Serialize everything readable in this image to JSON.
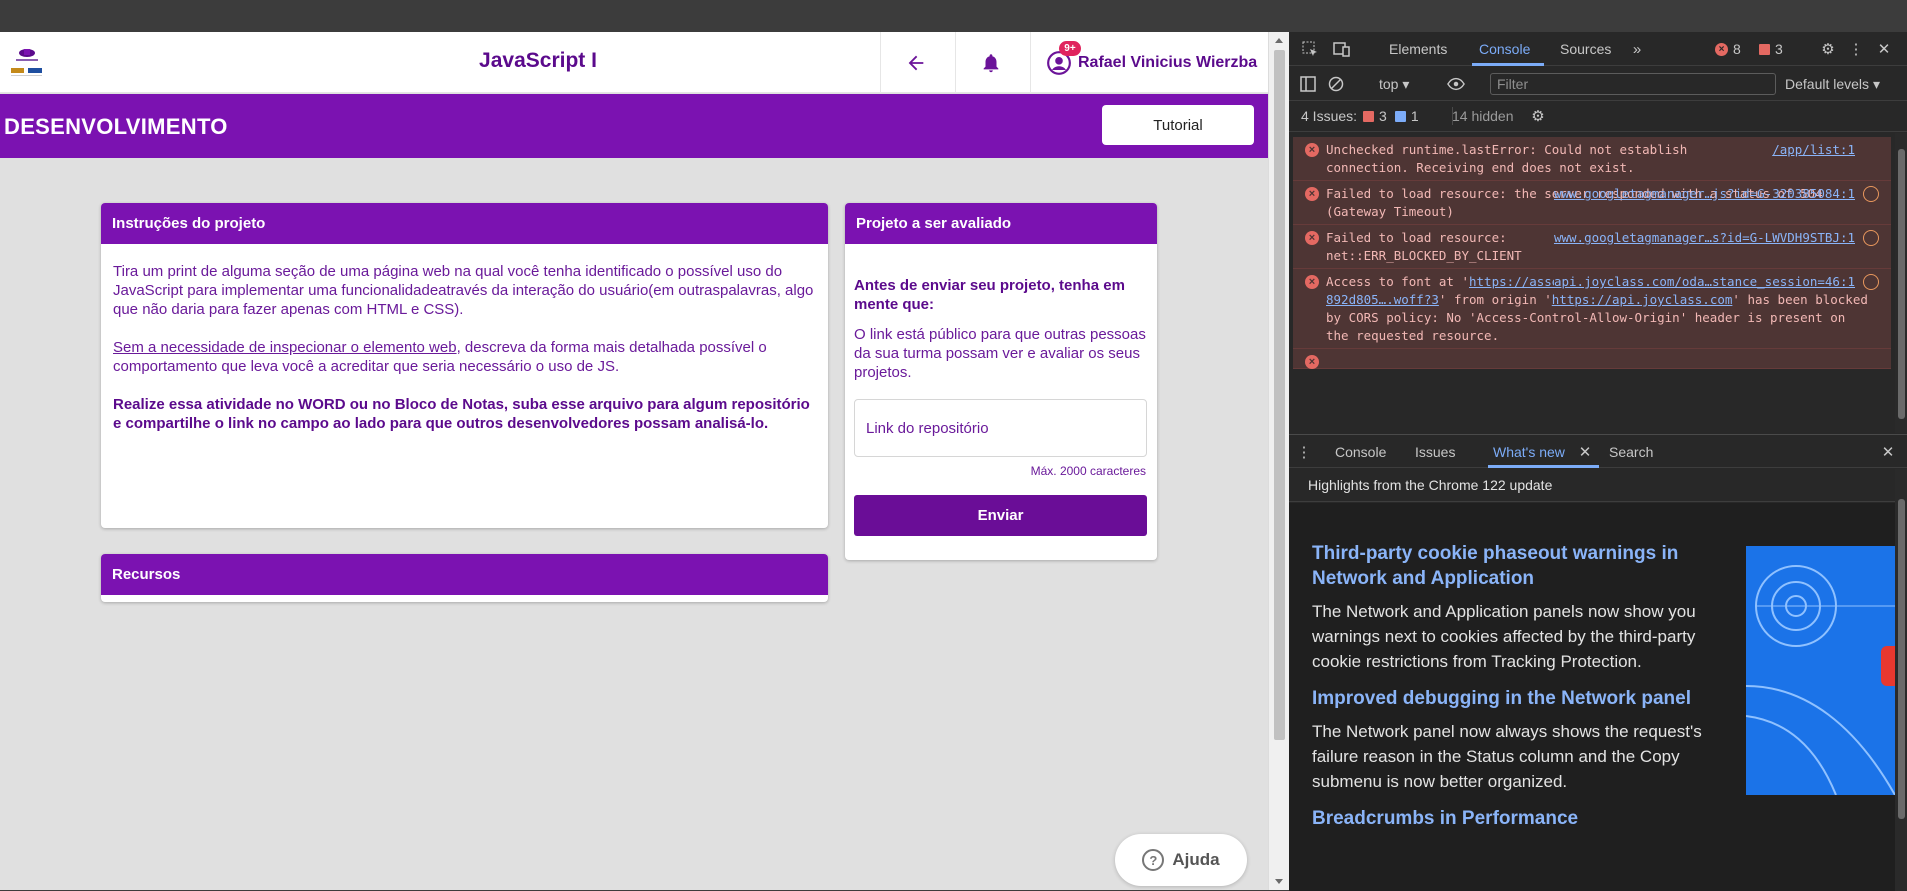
{
  "header": {
    "course_title": "JavaScript I",
    "notification_badge": "9+",
    "user_name": "Rafael Vinicius Wierzba"
  },
  "banner": {
    "title": "DESENVOLVIMENTO",
    "tutorial_label": "Tutorial"
  },
  "instructions": {
    "title": "Instruções do projeto",
    "p1": "Tira um print de alguma seção de uma página web na qual você tenha identificado o possível uso do JavaScript para implementar uma funcionalidadeatravés da interação do usuário(em outraspalavras, algo que não daria para fazer apenas com HTML e CSS).",
    "p2_link": "Sem a necessidade de inspecionar o elemento web",
    "p2_rest": ", descreva da forma mais detalhada possível o comportamento que leva você a acreditar que seria necessário o uso de JS.",
    "p3": "Realize essa atividade no WORD ou no Bloco de Notas, suba esse arquivo para algum repositório e compartilhe o link no campo ao lado para que outros desenvolvedores possam analisá-lo."
  },
  "resources": {
    "title": "Recursos"
  },
  "project": {
    "title": "Projeto a ser avaliado",
    "warning": "Antes de enviar seu projeto, tenha em mente que:",
    "note": "O link está público para que outras pessoas da sua turma possam ver e avaliar os seus projetos.",
    "repo_placeholder": "Link do repositório",
    "max_chars": "Máx. 2000 caracteres",
    "send_label": "Enviar"
  },
  "help": {
    "label": "Ajuda"
  },
  "devtools": {
    "tabs": [
      "Elements",
      "Console",
      "Sources"
    ],
    "active_tab": "Console",
    "error_count": "8",
    "issue_count": "3",
    "context": "top",
    "filter_placeholder": "Filter",
    "levels": "Default levels",
    "issues_label": "4 Issues:",
    "issues_errors": "3",
    "issues_info": "1",
    "hidden": "14 hidden",
    "messages": [
      {
        "text": "Unchecked runtime.lastError: Could not establish connection. Receiving end does not exist.",
        "source": "/app/list:1"
      },
      {
        "text": "Failed to load resource: the server responded with a status of 504 (Gateway Timeout)",
        "source": "www.googletagmanager…js?id=G-320385084:1"
      },
      {
        "text": "Failed to load resource: net::ERR_BLOCKED_BY_CLIENT",
        "source": "www.googletagmanager…s?id=G-LWVDH9STBJ:1"
      },
      {
        "text_a": "Access to font at '",
        "url1": "https://assets-v2.slid.es/assets/slides/slides-892d805….woff?3",
        "text_b": "' from origin '",
        "url2": "https://api.joyclass.com",
        "text_c": "' has been blocked by CORS policy: No 'Access-Control-Allow-Origin' header is present on the requested resource.",
        "source": "api.joyclass.com/oda…stance_session=46:1"
      }
    ],
    "drawer_tabs": [
      "Console",
      "Issues",
      "What's new",
      "Search"
    ],
    "drawer_active": "What's new",
    "whats_new_subtitle": "Highlights from the Chrome 122 update",
    "features": [
      {
        "title": "Third-party cookie phaseout warnings in Network and Application",
        "body": "The Network and Application panels now show you warnings next to cookies affected by the third-party cookie restrictions from Tracking Protection."
      },
      {
        "title": "Improved debugging in the Network panel",
        "body": "The Network panel now always shows the request's failure reason in the Status column and the Copy submenu is now better organized."
      },
      {
        "title": "Breadcrumbs in Performance",
        "body": ""
      }
    ]
  }
}
